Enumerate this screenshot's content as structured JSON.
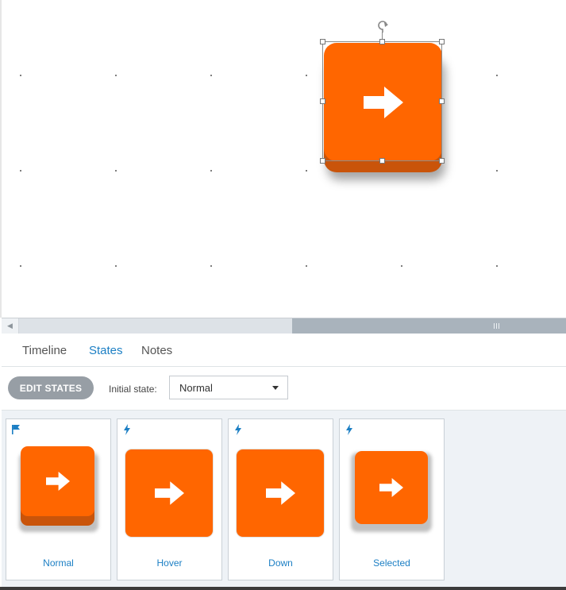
{
  "canvas": {
    "button_icon": "arrow-right-icon",
    "accent_color": "#ff6600",
    "depth_color": "#c9540a"
  },
  "tabs": [
    {
      "label": "Timeline",
      "active": false
    },
    {
      "label": "States",
      "active": true
    },
    {
      "label": "Notes",
      "active": false
    }
  ],
  "toolbar": {
    "edit_states_label": "EDIT STATES",
    "initial_state_label": "Initial state:",
    "initial_state_value": "Normal"
  },
  "states": [
    {
      "label": "Normal",
      "badge_icon": "flag-icon"
    },
    {
      "label": "Hover",
      "badge_icon": "lightning-icon"
    },
    {
      "label": "Down",
      "badge_icon": "lightning-icon"
    },
    {
      "label": "Selected",
      "badge_icon": "lightning-icon"
    }
  ],
  "colors": {
    "link_blue": "#1c7fc4",
    "panel_bg": "#eef2f6"
  }
}
